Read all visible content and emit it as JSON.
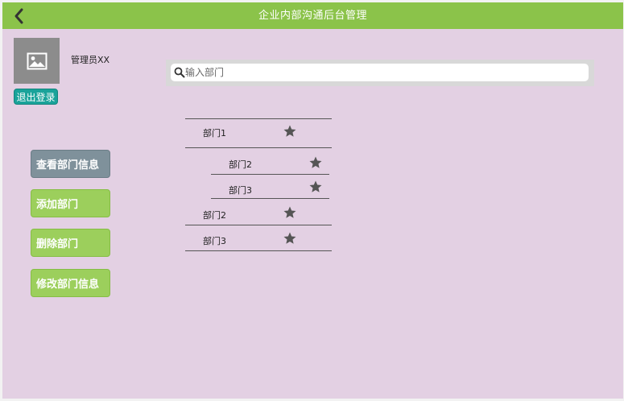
{
  "header": {
    "title": "企业内部沟通后台管理"
  },
  "profile": {
    "name": "管理员XX",
    "logout_label": "退出登录"
  },
  "menu": [
    {
      "label": "查看部门信息",
      "active": true
    },
    {
      "label": "添加部门",
      "active": false
    },
    {
      "label": "删除部门",
      "active": false
    },
    {
      "label": "修改部门信息",
      "active": false
    }
  ],
  "search": {
    "placeholder": "输入部门",
    "value": ""
  },
  "departments": [
    {
      "label": "部门1",
      "level": 0
    },
    {
      "label": "部门2",
      "level": 1
    },
    {
      "label": "部门3",
      "level": 1
    },
    {
      "label": "部门2",
      "level": 0
    },
    {
      "label": "部门3",
      "level": 0
    }
  ],
  "colors": {
    "header_bg": "#8bc34a",
    "page_bg": "#e3d0e3",
    "active_button": "#7f919b",
    "button": "#9ccf5c",
    "logout_button": "#1aa39a"
  },
  "icons": {
    "back": "chevron-left-icon",
    "avatar": "image-placeholder-icon",
    "search": "search-icon",
    "favorite": "star-icon"
  }
}
